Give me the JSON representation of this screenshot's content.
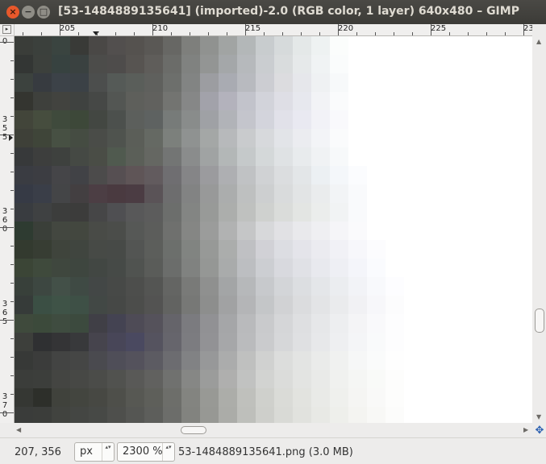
{
  "window": {
    "title": "[53-1484889135641] (imported)-2.0 (RGB color, 1 layer) 640x480 – GIMP",
    "close_glyph": "×",
    "minimize_glyph": "−",
    "maximize_glyph": "□"
  },
  "ruler": {
    "corner_glyph": "▸",
    "h_labels": [
      "205",
      "210",
      "215",
      "220",
      "225",
      "23"
    ],
    "v_labels": [
      [
        "3",
        "5",
        "5"
      ],
      [
        "3",
        "6",
        "0"
      ],
      [
        "3",
        "6",
        "5"
      ],
      [
        "3",
        "7",
        "0"
      ],
      [
        "0"
      ]
    ]
  },
  "canvas": {
    "cols": 28,
    "rows": 21,
    "pixels": [
      [
        "#3a3d39",
        "#3b403c",
        "#3a4440",
        "#393a37",
        "#4a4846",
        "#524f4e",
        "#55524f",
        "#5a5855",
        "#676764",
        "#7e7f7c",
        "#909290",
        "#a1a4a3",
        "#b3b7b8",
        "#c8ccce",
        "#d6dadb",
        "#e4e8e8",
        "#eef2f2",
        "#fbfdfc",
        "#ffffff",
        "#ffffff",
        "#ffffff",
        "#ffffff",
        "#ffffff",
        "#ffffff",
        "#ffffff",
        "#ffffff",
        "#ffffff",
        "#ffffff"
      ],
      [
        "#333634",
        "#3c403c",
        "#374240",
        "#3a4140",
        "#4c4c4a",
        "#4e4c4b",
        "#575451",
        "#5f5d5a",
        "#6b6c69",
        "#808280",
        "#939594",
        "#a4a7a9",
        "#b6b9bc",
        "#cacdd0",
        "#d9dcdd",
        "#e6e9ea",
        "#f0f3f4",
        "#fafcfc",
        "#ffffff",
        "#ffffff",
        "#ffffff",
        "#ffffff",
        "#ffffff",
        "#ffffff",
        "#ffffff",
        "#ffffff",
        "#ffffff",
        "#ffffff"
      ],
      [
        "#3c423e",
        "#373b40",
        "#3c4248",
        "#3b4146",
        "#4c4e4d",
        "#555a57",
        "#5a5e5a",
        "#5f605d",
        "#6d6f6c",
        "#828483",
        "#9c9da1",
        "#a9abb2",
        "#b8babf",
        "#cccdd2",
        "#dcdcdf",
        "#e6e7eb",
        "#eff1f3",
        "#f7f9fa",
        "#ffffff",
        "#ffffff",
        "#ffffff",
        "#ffffff",
        "#ffffff",
        "#ffffff",
        "#ffffff",
        "#ffffff",
        "#ffffff",
        "#ffffff"
      ],
      [
        "#343530",
        "#3e403c",
        "#42433f",
        "#3f4240",
        "#464846",
        "#535653",
        "#5e5f5b",
        "#61615e",
        "#737471",
        "#868787",
        "#a2a2aa",
        "#b3b2bc",
        "#c2c3cb",
        "#d2d3da",
        "#dedee5",
        "#e7e8ee",
        "#f2f3f6",
        "#fafbfc",
        "#ffffff",
        "#ffffff",
        "#ffffff",
        "#ffffff",
        "#ffffff",
        "#ffffff",
        "#ffffff",
        "#ffffff",
        "#ffffff",
        "#ffffff"
      ],
      [
        "#42453a",
        "#464d3e",
        "#3f4a3c",
        "#3d4839",
        "#434742",
        "#4c504d",
        "#5c5f5c",
        "#5e6261",
        "#777b79",
        "#898c8b",
        "#9fa1a5",
        "#b1b3b8",
        "#c4c5cc",
        "#d3d4dc",
        "#e1e1e9",
        "#e9e9f1",
        "#f2f2f7",
        "#f9f9fc",
        "#ffffff",
        "#ffffff",
        "#ffffff",
        "#ffffff",
        "#ffffff",
        "#ffffff",
        "#ffffff",
        "#ffffff",
        "#ffffff",
        "#ffffff"
      ],
      [
        "#3e4038",
        "#3f4539",
        "#475043",
        "#454c42",
        "#4a4c48",
        "#4f534e",
        "#5b5e58",
        "#656963",
        "#7c807c",
        "#8f9291",
        "#a4a7a6",
        "#b7b9bb",
        "#c9cbcd",
        "#d7d9dc",
        "#e2e4e8",
        "#ebecf0",
        "#f3f4f7",
        "#fafbfc",
        "#ffffff",
        "#ffffff",
        "#ffffff",
        "#ffffff",
        "#ffffff",
        "#ffffff",
        "#ffffff",
        "#ffffff",
        "#ffffff",
        "#ffffff"
      ],
      [
        "#37393a",
        "#3d3e3d",
        "#3e413e",
        "#454944",
        "#4a4d46",
        "#505a4f",
        "#5b5f58",
        "#656762",
        "#737574",
        "#8a8c8c",
        "#a0a3a3",
        "#b3b7b7",
        "#c5c9ca",
        "#d4d8d9",
        "#dfe2e4",
        "#e8ebed",
        "#f0f2f4",
        "#f7f9fa",
        "#ffffff",
        "#ffffff",
        "#ffffff",
        "#ffffff",
        "#ffffff",
        "#ffffff",
        "#ffffff",
        "#ffffff",
        "#ffffff",
        "#ffffff"
      ],
      [
        "#3a3c42",
        "#3c3d42",
        "#454548",
        "#414246",
        "#4c4b4b",
        "#564f52",
        "#5f5557",
        "#625b5e",
        "#6f6e71",
        "#858587",
        "#9b9b9e",
        "#aeafb2",
        "#c0c2c4",
        "#d0d2d4",
        "#dbdddf",
        "#e3e6e8",
        "#ecf0f3",
        "#f4f7fa",
        "#fbfcfe",
        "#ffffff",
        "#ffffff",
        "#ffffff",
        "#ffffff",
        "#ffffff",
        "#ffffff",
        "#ffffff",
        "#ffffff",
        "#ffffff"
      ],
      [
        "#363a45",
        "#3a3e48",
        "#444547",
        "#433f41",
        "#4c3e44",
        "#4a3a40",
        "#4b3c43",
        "#5a5357",
        "#6d6d6e",
        "#828383",
        "#989999",
        "#abadad",
        "#bec0c0",
        "#cdcfd0",
        "#d9dbdc",
        "#e2e4e5",
        "#eaeced",
        "#f2f4f6",
        "#f9fafc",
        "#ffffff",
        "#ffffff",
        "#ffffff",
        "#ffffff",
        "#ffffff",
        "#ffffff",
        "#ffffff",
        "#ffffff",
        "#ffffff"
      ],
      [
        "#393c40",
        "#3f4142",
        "#3c3d3c",
        "#3c3c3b",
        "#464647",
        "#4f4f52",
        "#585859",
        "#5c5c5c",
        "#6c6e6c",
        "#838583",
        "#989a98",
        "#acaeac",
        "#bfc1bf",
        "#cfd1cf",
        "#dadcda",
        "#e3e5e3",
        "#ebedec",
        "#f1f3f4",
        "#f9fafc",
        "#ffffff",
        "#ffffff",
        "#ffffff",
        "#ffffff",
        "#ffffff",
        "#ffffff",
        "#ffffff",
        "#ffffff",
        "#ffffff"
      ],
      [
        "#2e3b31",
        "#3a3f39",
        "#434740",
        "#43473f",
        "#494b47",
        "#4b4d4a",
        "#565856",
        "#5c5d5b",
        "#6f706e",
        "#858684",
        "#9b9c9b",
        "#b1b2b2",
        "#c5c6c7",
        "#d7d8da",
        "#e1e1e4",
        "#e9e9ec",
        "#efeff2",
        "#f5f5f8",
        "#fafafc",
        "#ffffff",
        "#ffffff",
        "#ffffff",
        "#ffffff",
        "#ffffff",
        "#ffffff",
        "#ffffff",
        "#ffffff",
        "#ffffff"
      ],
      [
        "#333a2f",
        "#373d33",
        "#3f443c",
        "#40453f",
        "#474a46",
        "#474a47",
        "#535553",
        "#5c5e5b",
        "#6c6f6c",
        "#818481",
        "#979997",
        "#abadac",
        "#bfc0c3",
        "#d1d1d6",
        "#dcdde2",
        "#e4e4ea",
        "#ebebf0",
        "#f1f1f6",
        "#f7f7fb",
        "#fcfcfe",
        "#ffffff",
        "#ffffff",
        "#ffffff",
        "#ffffff",
        "#ffffff",
        "#ffffff",
        "#ffffff",
        "#ffffff"
      ],
      [
        "#3b4536",
        "#3f4a3c",
        "#3f473e",
        "#3e463f",
        "#424743",
        "#464a47",
        "#505350",
        "#5a5c59",
        "#6b6d6b",
        "#808280",
        "#959795",
        "#a9abab",
        "#bcbec1",
        "#ccced2",
        "#d8d9de",
        "#e0e1e6",
        "#e8e9ee",
        "#eeeff4",
        "#f4f5fa",
        "#fafbfe",
        "#ffffff",
        "#ffffff",
        "#ffffff",
        "#ffffff",
        "#ffffff",
        "#ffffff",
        "#ffffff",
        "#ffffff"
      ],
      [
        "#38403a",
        "#3d4741",
        "#435048",
        "#3f4a44",
        "#434746",
        "#474947",
        "#4d4e4c",
        "#545553",
        "#646563",
        "#797a78",
        "#8f908f",
        "#a3a5a6",
        "#b6b8ba",
        "#c7c9cc",
        "#d3d5d8",
        "#dcdee1",
        "#e4e6e9",
        "#ebedf0",
        "#f2f3f7",
        "#f8f9fc",
        "#fdfdff",
        "#ffffff",
        "#ffffff",
        "#ffffff",
        "#ffffff",
        "#ffffff",
        "#ffffff",
        "#ffffff"
      ],
      [
        "#363b39",
        "#3b4f44",
        "#3f5347",
        "#3e5046",
        "#424845",
        "#464846",
        "#4c4d4b",
        "#535352",
        "#626361",
        "#777876",
        "#8d8e8d",
        "#a1a2a3",
        "#b4b5b7",
        "#c4c6c8",
        "#d1d2d4",
        "#dbdcde",
        "#e3e4e6",
        "#eaebed",
        "#f1f1f4",
        "#f7f7fa",
        "#fcfcfd",
        "#ffffff",
        "#ffffff",
        "#ffffff",
        "#ffffff",
        "#ffffff",
        "#ffffff",
        "#ffffff"
      ],
      [
        "#3f4a3c",
        "#3c4a3b",
        "#3f4c40",
        "#3c4a3e",
        "#403f46",
        "#444352",
        "#4e4b56",
        "#55525b",
        "#65646a",
        "#7b7b7f",
        "#919194",
        "#a5a6a8",
        "#b9babc",
        "#c9cacc",
        "#d5d6d8",
        "#dedfe1",
        "#e6e7e9",
        "#edeef0",
        "#f4f4f6",
        "#f9f9fb",
        "#fdfdfe",
        "#ffffff",
        "#ffffff",
        "#ffffff",
        "#ffffff",
        "#ffffff",
        "#ffffff",
        "#ffffff"
      ],
      [
        "#3d3f3b",
        "#2f3032",
        "#343436",
        "#38393b",
        "#46444d",
        "#484658",
        "#4a4960",
        "#55535f",
        "#66656c",
        "#7c7c80",
        "#929295",
        "#a6a7a9",
        "#babbbd",
        "#cacbcd",
        "#d6d7d9",
        "#dfe0e2",
        "#e7e8ea",
        "#eeeff1",
        "#f4f5f7",
        "#f9fafb",
        "#fdfdfe",
        "#ffffff",
        "#ffffff",
        "#ffffff",
        "#ffffff",
        "#ffffff",
        "#ffffff",
        "#ffffff"
      ],
      [
        "#373937",
        "#3b3c3b",
        "#434443",
        "#454645",
        "#4a4a4f",
        "#4f4e58",
        "#54525c",
        "#5c5b62",
        "#6c6c70",
        "#818284",
        "#979899",
        "#abacac",
        "#bfc0bf",
        "#d0d1d0",
        "#dcdddc",
        "#e3e4e3",
        "#eaebea",
        "#f0f1f0",
        "#f6f7f7",
        "#fafbfb",
        "#fefefe",
        "#ffffff",
        "#ffffff",
        "#ffffff",
        "#ffffff",
        "#ffffff",
        "#ffffff",
        "#ffffff"
      ],
      [
        "#3b3d3a",
        "#3c3e3b",
        "#444542",
        "#474845",
        "#4b4c49",
        "#51524f",
        "#595957",
        "#61615f",
        "#70716f",
        "#868785",
        "#9b9c9b",
        "#afafae",
        "#c1c2c1",
        "#d2d3d1",
        "#dbdcda",
        "#e3e4e2",
        "#e9eae8",
        "#f0f1ef",
        "#f5f6f4",
        "#f9faf8",
        "#fdfdfc",
        "#ffffff",
        "#ffffff",
        "#ffffff",
        "#ffffff",
        "#ffffff",
        "#ffffff",
        "#ffffff"
      ],
      [
        "#353733",
        "#2d2f2a",
        "#40423c",
        "#43453f",
        "#474843",
        "#4e4f4a",
        "#575853",
        "#5e5f5a",
        "#6d6e6a",
        "#838480",
        "#989995",
        "#acada9",
        "#bfc0bc",
        "#cfd0cc",
        "#dadbd7",
        "#e2e3df",
        "#e9eae7",
        "#eff0ed",
        "#f5f5f3",
        "#f9f9f8",
        "#fdfdfc",
        "#ffffff",
        "#ffffff",
        "#ffffff",
        "#ffffff",
        "#ffffff",
        "#ffffff",
        "#ffffff"
      ],
      [
        "#3a3c3a",
        "#3b3d3a",
        "#41433f",
        "#444643",
        "#474946",
        "#4e4f4c",
        "#555653",
        "#5d5e5b",
        "#6c6d6a",
        "#82837f",
        "#979894",
        "#abaca8",
        "#bebfbb",
        "#cecfcb",
        "#d9dad6",
        "#e1e2de",
        "#e8e9e5",
        "#eeefeb",
        "#f4f4f1",
        "#f8f8f6",
        "#fcfcfb",
        "#ffffff",
        "#ffffff",
        "#ffffff",
        "#ffffff",
        "#ffffff",
        "#ffffff",
        "#ffffff"
      ]
    ]
  },
  "status": {
    "coords": "207, 356",
    "unit": "px",
    "zoom": "2300 %",
    "filename": "53-1484889135641.png (3.0 MB)",
    "spin_glyph": "▴▾"
  },
  "scrollbars": {
    "up": "▲",
    "down": "▼",
    "left": "◀",
    "right": "▶",
    "nav_glyph": "✥"
  }
}
